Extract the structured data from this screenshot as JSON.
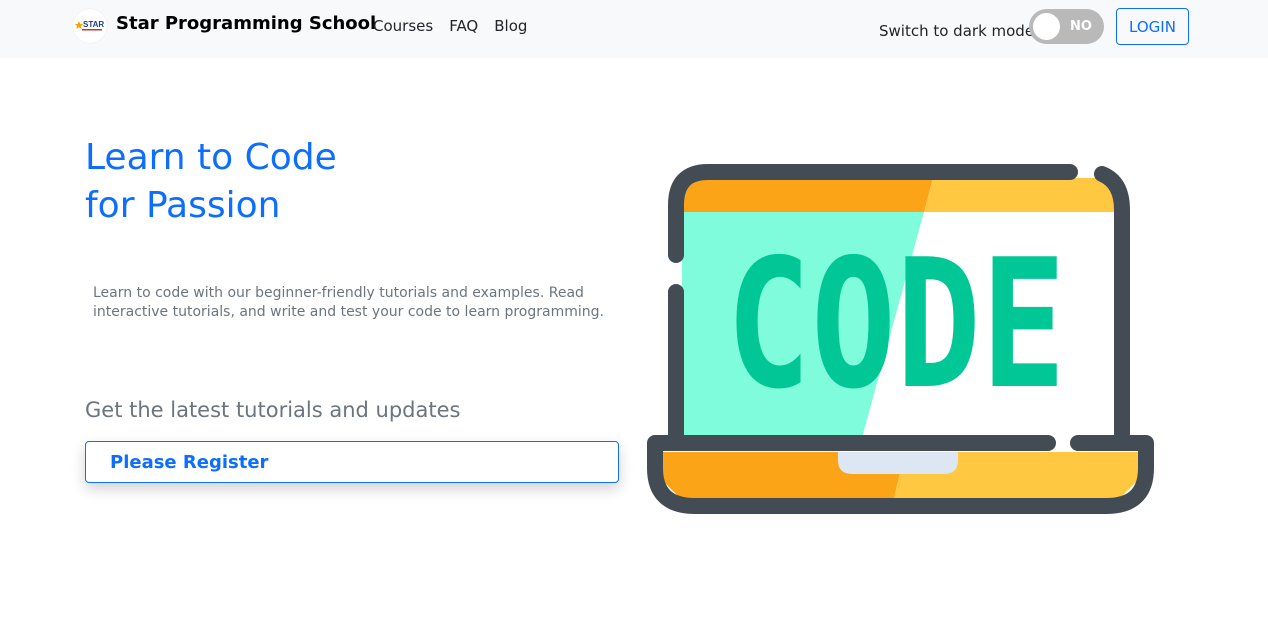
{
  "navbar": {
    "logo_text": "STAR",
    "brand": "Star Programming School",
    "links": [
      "Courses",
      "FAQ",
      "Blog"
    ],
    "dark_mode_label": "Switch to dark mode",
    "toggle_state": "NO",
    "login_label": "LOGIN"
  },
  "hero": {
    "title_line1": "Learn to Code",
    "title_line2": "for Passion",
    "description": "Learn to code with our beginner-friendly tutorials and examples. Read interactive tutorials, and write and test your code to learn programming.",
    "updates_heading": "Get the latest tutorials and updates",
    "register_label": "Please Register"
  },
  "illustration": {
    "screen_text": "CODE",
    "icon": "laptop-code-illustration"
  },
  "colors": {
    "primary": "#0d6efd",
    "muted": "#6c757d",
    "navbar_bg": "#f8f9fa",
    "laptop_frame": "#434c54",
    "screen_mint": "#7ffcdc",
    "code_green": "#00c795",
    "orange": "#fca417",
    "yellow": "#ffc840"
  }
}
